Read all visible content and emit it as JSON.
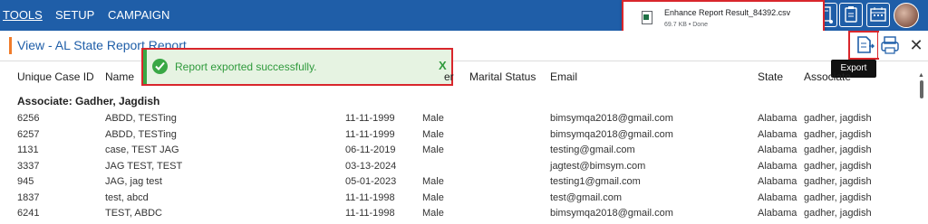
{
  "nav": {
    "tools": "TOOLS",
    "setup": "SETUP",
    "campaign": "CAMPAIGN"
  },
  "download": {
    "file_name": "Enhance Report Result_84392.csv",
    "status": "69.7 KB • Done",
    "icon": "excel-file-icon"
  },
  "panel": {
    "title": "View - AL State Report Report",
    "export_tooltip": "Export",
    "close_icon": "close-icon"
  },
  "toast": {
    "message": "Report exported successfully.",
    "close": "X"
  },
  "table": {
    "headers": [
      "Unique Case ID",
      "Name",
      "",
      "er",
      "Marital Status",
      "Email",
      "State",
      "Associate"
    ],
    "group": "Associate: Gadher, Jagdish",
    "rows": [
      [
        "6256",
        "ABDD, TESTing",
        "11-11-1999",
        "Male",
        "",
        "bimsymqa2018@gmail.com",
        "Alabama",
        "gadher, jagdish"
      ],
      [
        "6257",
        "ABDD, TESTing",
        "11-11-1999",
        "Male",
        "",
        "bimsymqa2018@gmail.com",
        "Alabama",
        "gadher, jagdish"
      ],
      [
        "1131",
        "case, TEST JAG",
        "06-11-2019",
        "Male",
        "",
        "testing@gmail.com",
        "Alabama",
        "gadher, jagdish"
      ],
      [
        "3337",
        "JAG TEST, TEST",
        "03-13-2024",
        "",
        "",
        "jagtest@bimsym.com",
        "Alabama",
        "gadher, jagdish"
      ],
      [
        "945",
        "JAG, jag test",
        "05-01-2023",
        "Male",
        "",
        "testing1@gmail.com",
        "Alabama",
        "gadher, jagdish"
      ],
      [
        "1837",
        "test, abcd",
        "11-11-1998",
        "Male",
        "",
        "test@gmail.com",
        "Alabama",
        "gadher, jagdish"
      ],
      [
        "6241",
        "TEST, ABDC",
        "11-11-1998",
        "Male",
        "",
        "bimsymqa2018@gmail.com",
        "Alabama",
        "gadher, jagdish"
      ]
    ]
  },
  "colors": {
    "brand": "#1f5ea8",
    "success": "#39a845",
    "highlight": "#d9262c",
    "accent": "#f07c2a"
  }
}
